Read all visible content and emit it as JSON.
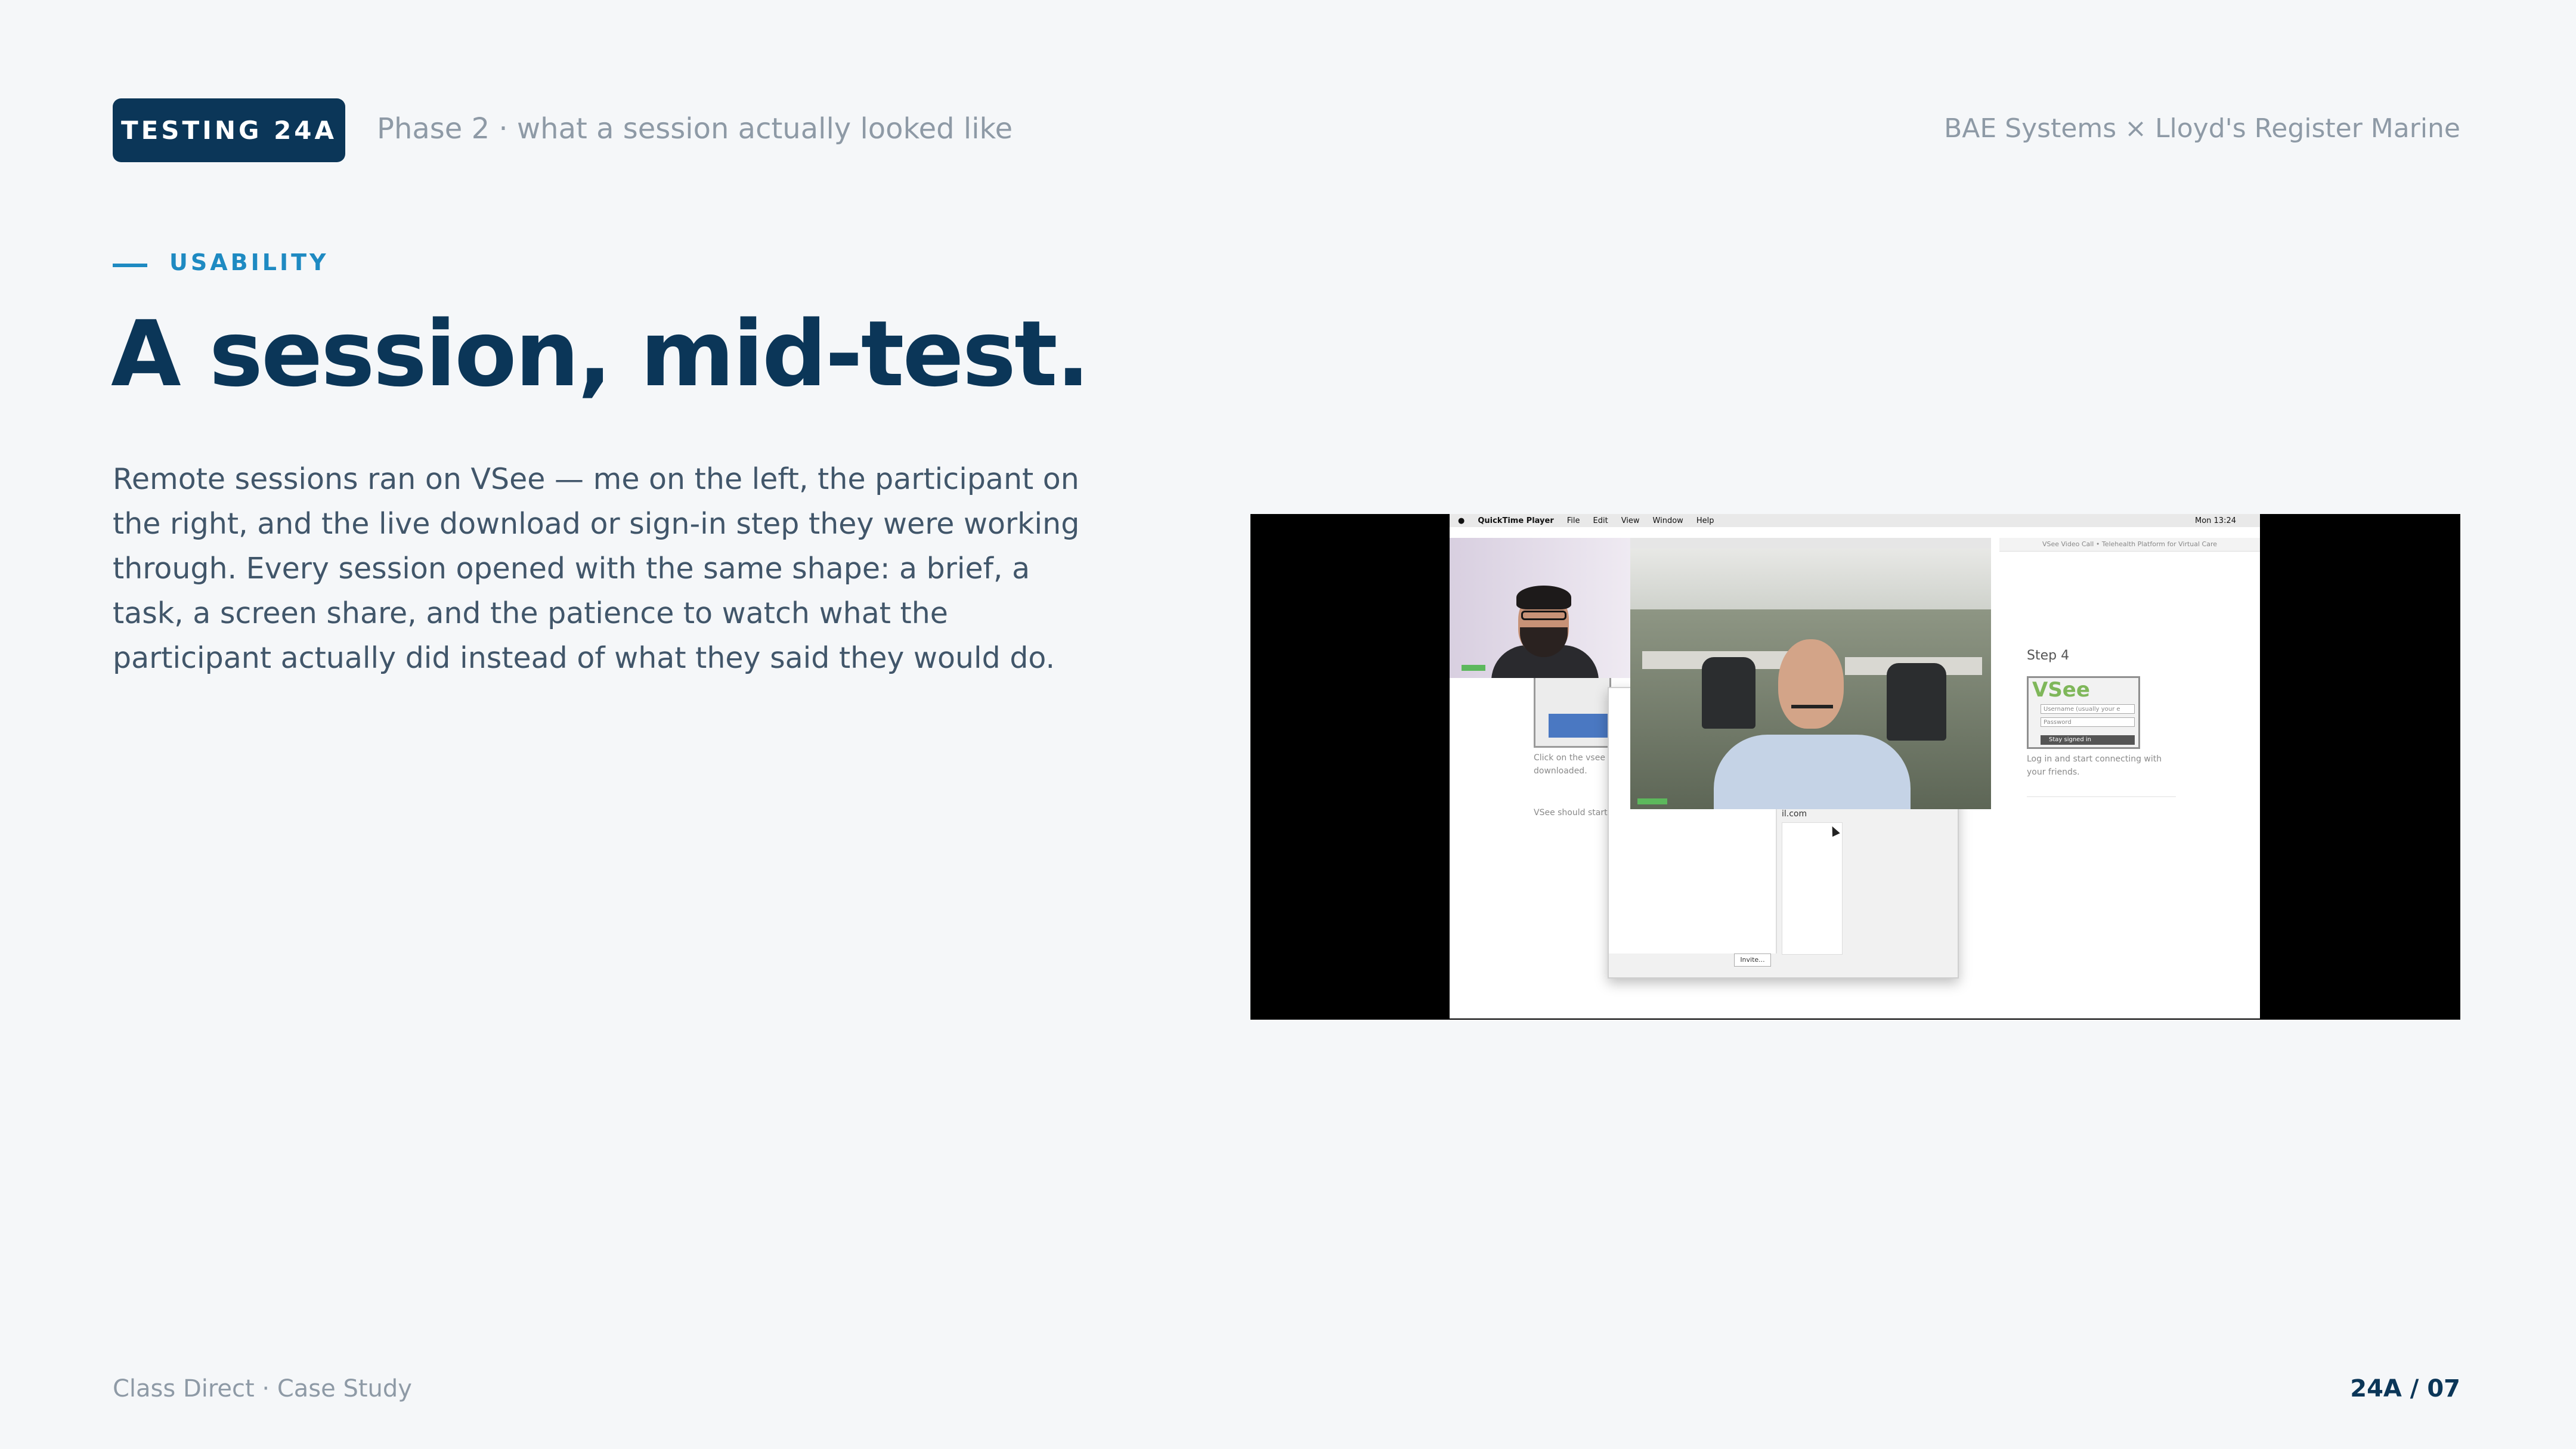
{
  "header": {
    "badge": "TESTING 24A",
    "phase": "Phase 2 · what a session actually looked like",
    "client": "BAE Systems × Lloyd's Register Marine"
  },
  "section": {
    "eyebrow": "USABILITY",
    "title": "A session, mid-test.",
    "body": "Remote sessions ran on VSee — me on the left, the participant on the right, and the live download or sign-in step they were working through. Every session opened with the same shape: a brief, a task, a screen share, and the patience to watch what the participant actually did instead of what they said they would do."
  },
  "screenshot": {
    "menubar": {
      "app": "QuickTime Player",
      "menus": [
        "File",
        "Edit",
        "View",
        "Window",
        "Help"
      ],
      "clock": "Mon 13:24"
    },
    "browser_title": "VSee Video Call • Telehealth Platform for Virtual Care",
    "step_label": "Step 4",
    "login": {
      "logo": "VSee",
      "username_placeholder": "Username (usually your e",
      "password_placeholder": "Password",
      "button": "Stay signed in"
    },
    "caption_right": "Log in and start connecting with your friends.",
    "caption_left": "Click on the vsee downloaded.",
    "caption_left_2": "VSee should start",
    "invite_label": "Invite...",
    "email_fragment": "il.com"
  },
  "footer": {
    "left": "Class Direct · Case Study",
    "right": "24A / 07"
  },
  "colors": {
    "navy": "#0b3658",
    "accent": "#1e8ac2",
    "muted": "#8e9aa6",
    "body": "#41566a",
    "background": "#f5f7f9"
  }
}
